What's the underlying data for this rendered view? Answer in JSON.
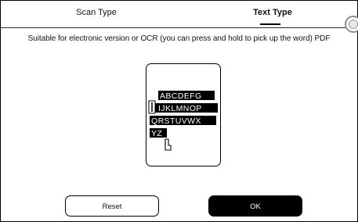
{
  "tabs": [
    {
      "label": "Scan Type",
      "selected": false
    },
    {
      "label": "Text Type",
      "selected": true
    }
  ],
  "description": "Suitable for electronic version or OCR (you can press and hold to pick up the word) PDF",
  "illustration": {
    "text_lines": [
      "ABCDEFG",
      "IJKLMNOP",
      "QRSTUVWX",
      "YZ"
    ],
    "icons": [
      "text-cursor-icon",
      "pointer-hand-icon"
    ]
  },
  "buttons": {
    "reset_label": "Reset",
    "ok_label": "OK"
  }
}
